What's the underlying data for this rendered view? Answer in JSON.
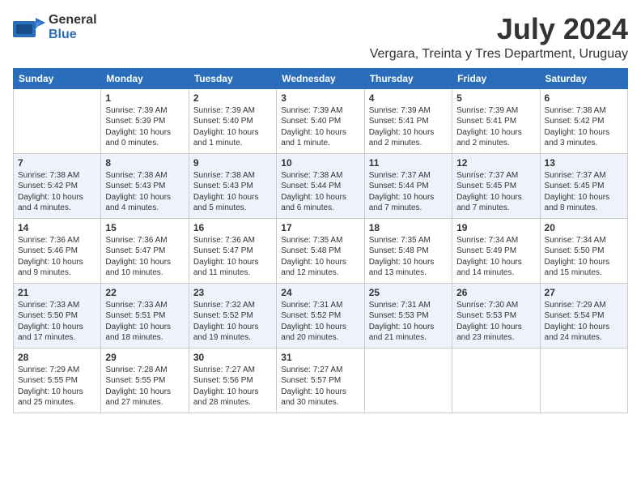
{
  "logo": {
    "general": "General",
    "blue": "Blue"
  },
  "title": {
    "month_year": "July 2024",
    "location": "Vergara, Treinta y Tres Department, Uruguay"
  },
  "days_of_week": [
    "Sunday",
    "Monday",
    "Tuesday",
    "Wednesday",
    "Thursday",
    "Friday",
    "Saturday"
  ],
  "weeks": [
    [
      {
        "day": "",
        "info": ""
      },
      {
        "day": "1",
        "info": "Sunrise: 7:39 AM\nSunset: 5:39 PM\nDaylight: 10 hours\nand 0 minutes."
      },
      {
        "day": "2",
        "info": "Sunrise: 7:39 AM\nSunset: 5:40 PM\nDaylight: 10 hours\nand 1 minute."
      },
      {
        "day": "3",
        "info": "Sunrise: 7:39 AM\nSunset: 5:40 PM\nDaylight: 10 hours\nand 1 minute."
      },
      {
        "day": "4",
        "info": "Sunrise: 7:39 AM\nSunset: 5:41 PM\nDaylight: 10 hours\nand 2 minutes."
      },
      {
        "day": "5",
        "info": "Sunrise: 7:39 AM\nSunset: 5:41 PM\nDaylight: 10 hours\nand 2 minutes."
      },
      {
        "day": "6",
        "info": "Sunrise: 7:38 AM\nSunset: 5:42 PM\nDaylight: 10 hours\nand 3 minutes."
      }
    ],
    [
      {
        "day": "7",
        "info": "Sunrise: 7:38 AM\nSunset: 5:42 PM\nDaylight: 10 hours\nand 4 minutes."
      },
      {
        "day": "8",
        "info": "Sunrise: 7:38 AM\nSunset: 5:43 PM\nDaylight: 10 hours\nand 4 minutes."
      },
      {
        "day": "9",
        "info": "Sunrise: 7:38 AM\nSunset: 5:43 PM\nDaylight: 10 hours\nand 5 minutes."
      },
      {
        "day": "10",
        "info": "Sunrise: 7:38 AM\nSunset: 5:44 PM\nDaylight: 10 hours\nand 6 minutes."
      },
      {
        "day": "11",
        "info": "Sunrise: 7:37 AM\nSunset: 5:44 PM\nDaylight: 10 hours\nand 7 minutes."
      },
      {
        "day": "12",
        "info": "Sunrise: 7:37 AM\nSunset: 5:45 PM\nDaylight: 10 hours\nand 7 minutes."
      },
      {
        "day": "13",
        "info": "Sunrise: 7:37 AM\nSunset: 5:45 PM\nDaylight: 10 hours\nand 8 minutes."
      }
    ],
    [
      {
        "day": "14",
        "info": "Sunrise: 7:36 AM\nSunset: 5:46 PM\nDaylight: 10 hours\nand 9 minutes."
      },
      {
        "day": "15",
        "info": "Sunrise: 7:36 AM\nSunset: 5:47 PM\nDaylight: 10 hours\nand 10 minutes."
      },
      {
        "day": "16",
        "info": "Sunrise: 7:36 AM\nSunset: 5:47 PM\nDaylight: 10 hours\nand 11 minutes."
      },
      {
        "day": "17",
        "info": "Sunrise: 7:35 AM\nSunset: 5:48 PM\nDaylight: 10 hours\nand 12 minutes."
      },
      {
        "day": "18",
        "info": "Sunrise: 7:35 AM\nSunset: 5:48 PM\nDaylight: 10 hours\nand 13 minutes."
      },
      {
        "day": "19",
        "info": "Sunrise: 7:34 AM\nSunset: 5:49 PM\nDaylight: 10 hours\nand 14 minutes."
      },
      {
        "day": "20",
        "info": "Sunrise: 7:34 AM\nSunset: 5:50 PM\nDaylight: 10 hours\nand 15 minutes."
      }
    ],
    [
      {
        "day": "21",
        "info": "Sunrise: 7:33 AM\nSunset: 5:50 PM\nDaylight: 10 hours\nand 17 minutes."
      },
      {
        "day": "22",
        "info": "Sunrise: 7:33 AM\nSunset: 5:51 PM\nDaylight: 10 hours\nand 18 minutes."
      },
      {
        "day": "23",
        "info": "Sunrise: 7:32 AM\nSunset: 5:52 PM\nDaylight: 10 hours\nand 19 minutes."
      },
      {
        "day": "24",
        "info": "Sunrise: 7:31 AM\nSunset: 5:52 PM\nDaylight: 10 hours\nand 20 minutes."
      },
      {
        "day": "25",
        "info": "Sunrise: 7:31 AM\nSunset: 5:53 PM\nDaylight: 10 hours\nand 21 minutes."
      },
      {
        "day": "26",
        "info": "Sunrise: 7:30 AM\nSunset: 5:53 PM\nDaylight: 10 hours\nand 23 minutes."
      },
      {
        "day": "27",
        "info": "Sunrise: 7:29 AM\nSunset: 5:54 PM\nDaylight: 10 hours\nand 24 minutes."
      }
    ],
    [
      {
        "day": "28",
        "info": "Sunrise: 7:29 AM\nSunset: 5:55 PM\nDaylight: 10 hours\nand 25 minutes."
      },
      {
        "day": "29",
        "info": "Sunrise: 7:28 AM\nSunset: 5:55 PM\nDaylight: 10 hours\nand 27 minutes."
      },
      {
        "day": "30",
        "info": "Sunrise: 7:27 AM\nSunset: 5:56 PM\nDaylight: 10 hours\nand 28 minutes."
      },
      {
        "day": "31",
        "info": "Sunrise: 7:27 AM\nSunset: 5:57 PM\nDaylight: 10 hours\nand 30 minutes."
      },
      {
        "day": "",
        "info": ""
      },
      {
        "day": "",
        "info": ""
      },
      {
        "day": "",
        "info": ""
      }
    ]
  ]
}
